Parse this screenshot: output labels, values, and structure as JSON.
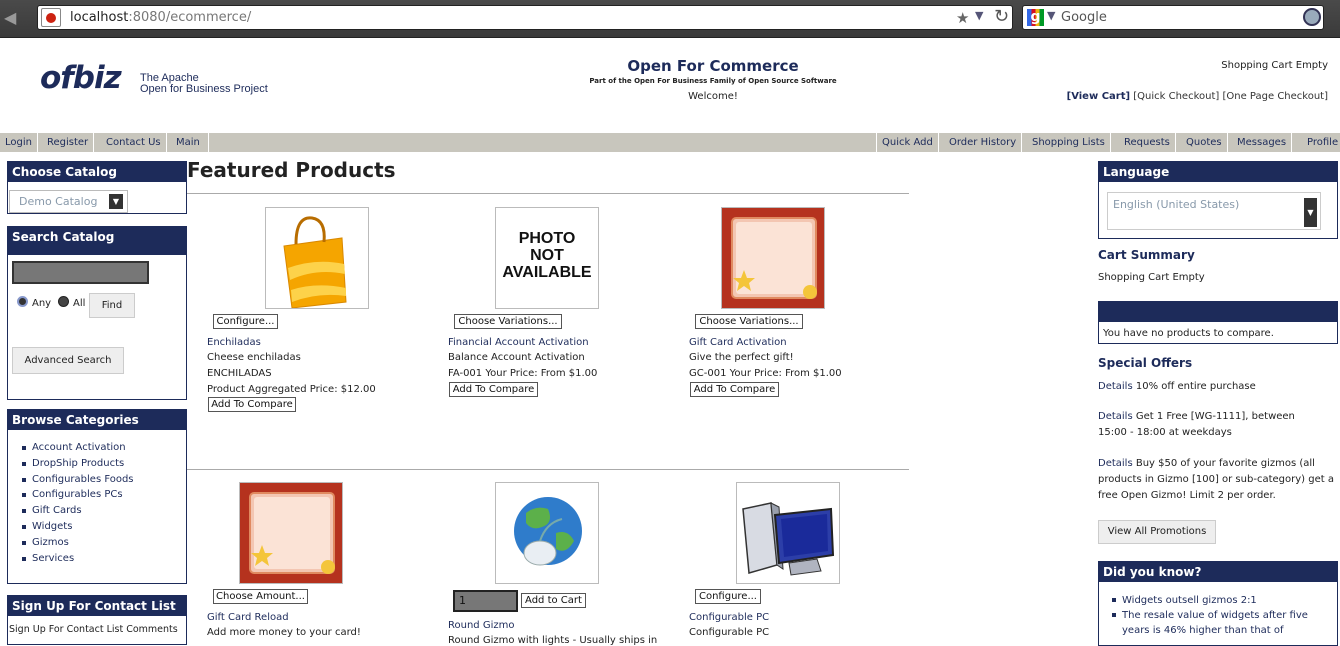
{
  "browser": {
    "url_host": "localhost",
    "url_rest": ":8080/ecommerce/",
    "search_placeholder": "Google"
  },
  "header": {
    "logo_text": "ofbiz",
    "logo_line1": "The Apache",
    "logo_line2": "Open for Business Project",
    "title": "Open For Commerce",
    "subtitle": "Part of the Open For Business Family of Open Source Software",
    "welcome": "Welcome!",
    "cart_status": "Shopping Cart Empty",
    "view_cart": "[View Cart]",
    "quick_checkout": "[Quick Checkout]",
    "one_page_checkout": "[One Page Checkout]"
  },
  "nav": {
    "left": [
      "Login",
      "Register",
      "Contact Us",
      "Main"
    ],
    "right": [
      "Quick Add",
      "Order History",
      "Shopping Lists",
      "Requests",
      "Quotes",
      "Messages",
      "Profile"
    ]
  },
  "choose_catalog": {
    "title": "Choose Catalog",
    "selected": "Demo Catalog"
  },
  "search_catalog": {
    "title": "Search Catalog",
    "any": "Any",
    "all": "All",
    "find": "Find",
    "advanced": "Advanced Search"
  },
  "browse": {
    "title": "Browse Categories",
    "items": [
      "Account Activation",
      "DropShip Products",
      "Configurables Foods",
      "Configurables PCs",
      "Gift Cards",
      "Widgets",
      "Gizmos",
      "Services"
    ]
  },
  "signup": {
    "title": "Sign Up For Contact List",
    "text": "Sign Up For Contact List Comments"
  },
  "main": {
    "title": "Featured Products",
    "products": [
      {
        "button": "Configure...",
        "name": "Enchiladas",
        "desc": "Cheese enchiladas",
        "id": "ENCHILADAS",
        "price": "Product Aggregated Price: $12.00",
        "compare": "Add To Compare"
      },
      {
        "button": "Choose Variations...",
        "name": "Financial Account Activation",
        "desc": "Balance Account Activation",
        "price": "FA-001 Your Price: From $1.00",
        "compare": "Add To Compare"
      },
      {
        "button": "Choose Variations...",
        "name": "Gift Card Activation",
        "desc": "Give the perfect gift!",
        "price": "GC-001 Your Price: From $1.00",
        "compare": "Add To Compare"
      },
      {
        "button": "Choose Amount...",
        "name": "Gift Card Reload",
        "desc": "Add more money to your card!"
      },
      {
        "qty": "1",
        "button": "Add to Cart",
        "name": "Round Gizmo",
        "desc": "Round Gizmo with lights - Usually ships in"
      },
      {
        "button": "Configure...",
        "name": "Configurable PC",
        "desc": "Configurable PC"
      }
    ],
    "photo_na_line1": "PHOTO",
    "photo_na_line2": "NOT",
    "photo_na_line3": "AVAILABLE"
  },
  "right": {
    "language_title": "Language",
    "language_selected": "English (United States)",
    "cart_summary_title": "Cart Summary",
    "cart_summary_text": "Shopping Cart Empty",
    "compare_text": "You have no products to compare.",
    "offers_title": "Special Offers",
    "offers": [
      {
        "label": "Details",
        "text": "10% off entire purchase"
      },
      {
        "label": "Details",
        "text": "Get 1 Free [WG-1111], between 15:00 - 18:00 at weekdays"
      },
      {
        "label": "Details",
        "text": "Buy $50 of your favorite gizmos (all products in Gizmo [100] or sub-category) get a free Open Gizmo! Limit 2 per order."
      }
    ],
    "view_promotions": "View All Promotions",
    "dyk_title": "Did you know?",
    "dyk": [
      "Widgets outsell gizmos 2:1",
      "The resale value of widgets after five years is 46% higher than that of"
    ]
  }
}
